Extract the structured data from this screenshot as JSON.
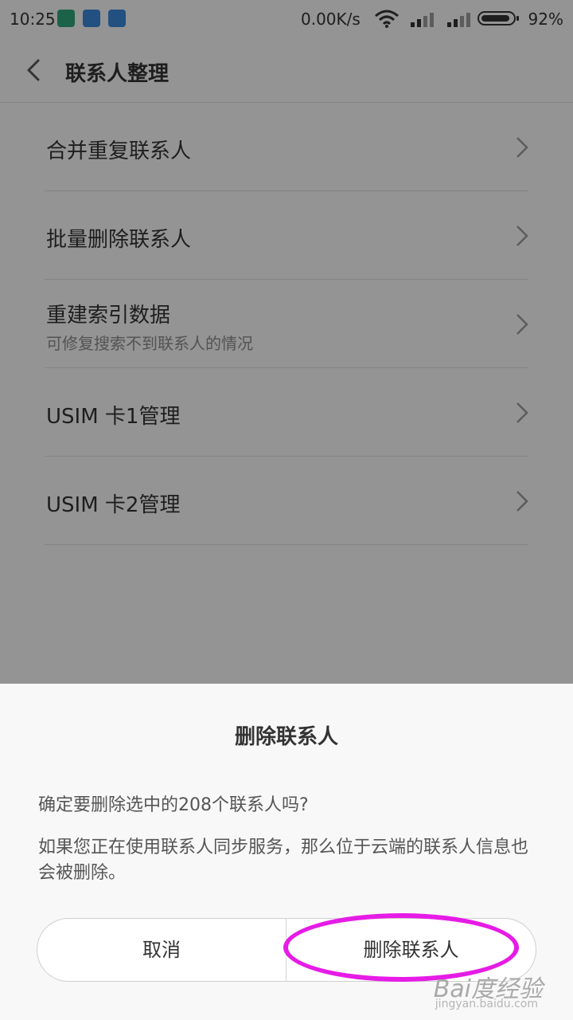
{
  "status_bar": {
    "time": "10:25",
    "network_speed": "0.00K/s",
    "battery_percent": "92%",
    "icons": [
      "shield-icon",
      "contact-icon",
      "contact-icon",
      "wifi-icon",
      "signal-icon",
      "signal-icon",
      "battery-icon"
    ]
  },
  "app_bar": {
    "title": "联系人整理"
  },
  "menu": {
    "items": [
      {
        "label": "合并重复联系人"
      },
      {
        "label": "批量删除联系人"
      },
      {
        "label": "重建索引数据",
        "subtitle": "可修复搜索不到联系人的情况"
      },
      {
        "label": "USIM 卡1管理"
      },
      {
        "label": "USIM 卡2管理"
      }
    ]
  },
  "dialog": {
    "title": "删除联系人",
    "question": "确定要删除选中的208个联系人吗?",
    "note": "如果您正在使用联系人同步服务，那么位于云端的联系人信息也会被删除。",
    "cancel_label": "取消",
    "confirm_label": "删除联系人"
  },
  "watermark": {
    "brand": "Bai度经验",
    "url": "jingyan.baidu.com"
  },
  "colors": {
    "annotation": "#e61ce6",
    "overlay": "rgba(0,0,0,0.40)"
  }
}
